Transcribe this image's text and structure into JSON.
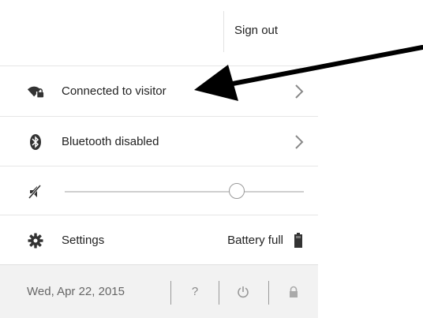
{
  "header": {
    "signout_label": "Sign out"
  },
  "network": {
    "label": "Connected to visitor",
    "icon": "wifi-locked-icon"
  },
  "bluetooth": {
    "label": "Bluetooth disabled",
    "icon": "bluetooth-icon"
  },
  "volume": {
    "icon": "volume-muted-icon",
    "level": 0.72
  },
  "settings": {
    "label": "Settings",
    "icon": "gear-icon"
  },
  "battery": {
    "label": "Battery full",
    "icon": "battery-full-icon"
  },
  "footer": {
    "date": "Wed, Apr 22, 2015",
    "help_label": "?",
    "power_icon": "power-icon",
    "lock_icon": "lock-icon"
  },
  "colors": {
    "text": "#222222",
    "muted": "#888888",
    "footer_bg": "#f2f2f2",
    "arrow": "#000000"
  }
}
